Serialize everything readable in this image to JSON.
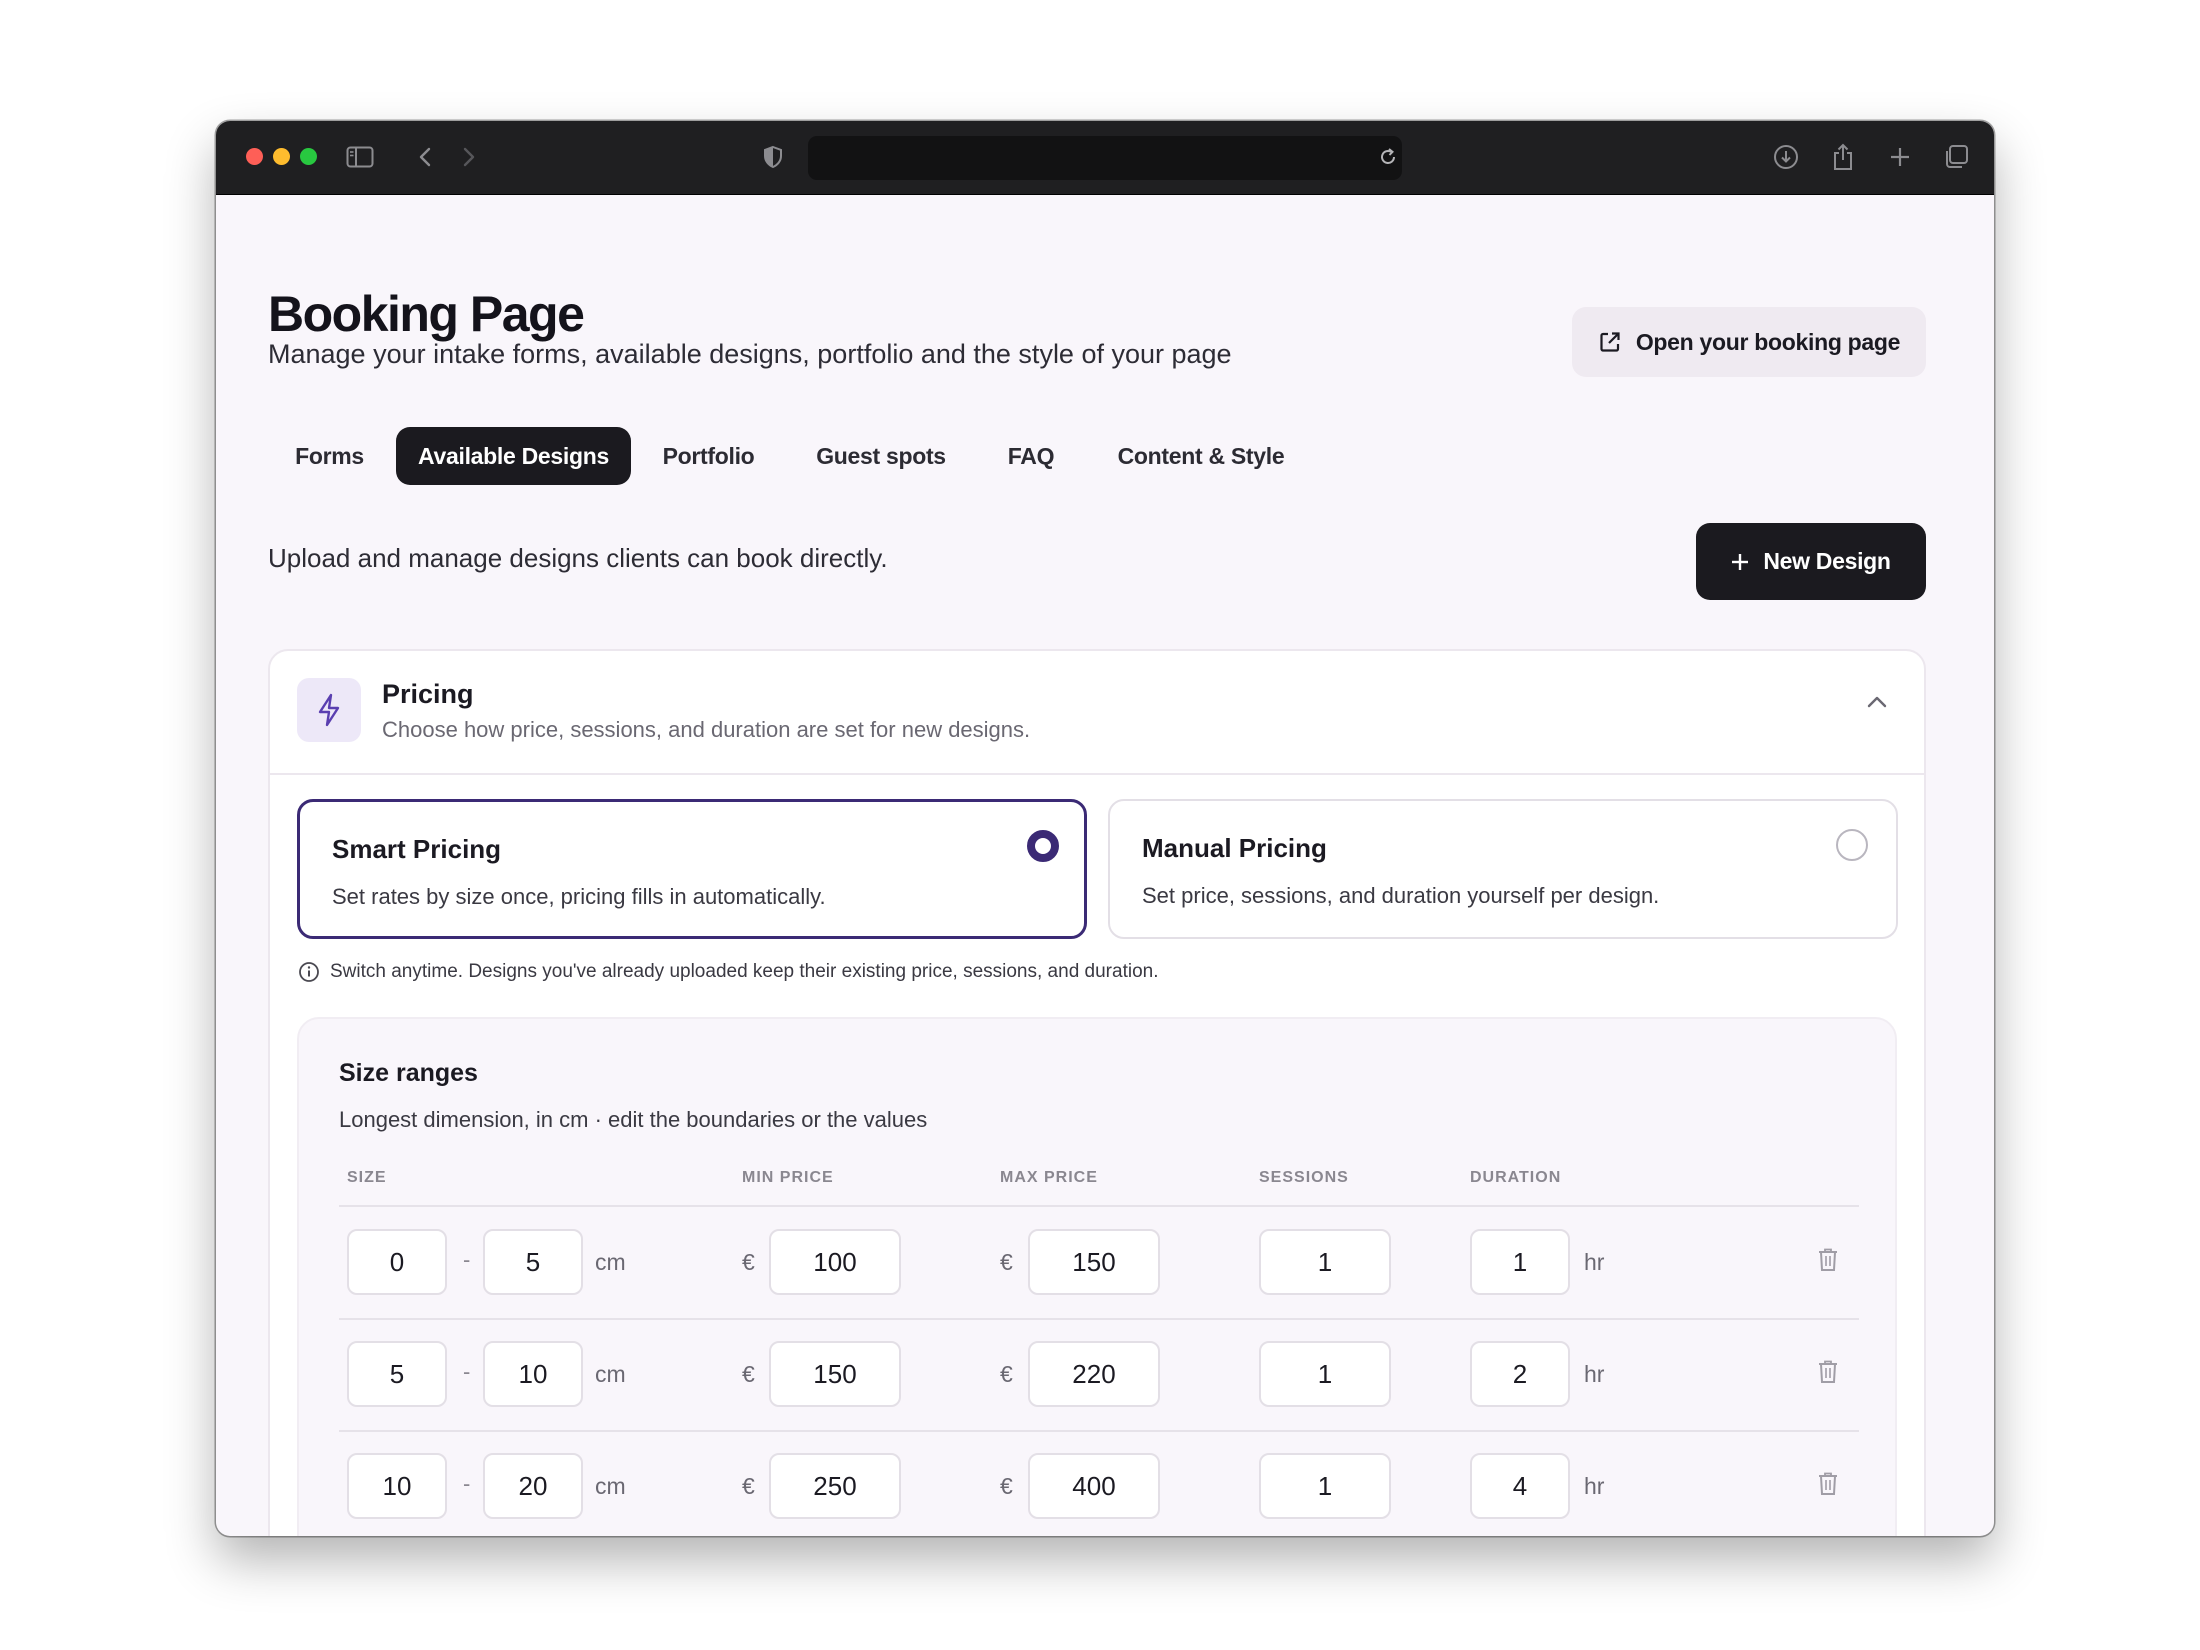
{
  "browser": {
    "icons": [
      "sidebar-icon",
      "back-icon",
      "forward-icon",
      "shield-icon",
      "reload-icon",
      "download-icon",
      "share-icon",
      "new-tab-icon",
      "tabs-overview-icon"
    ]
  },
  "header": {
    "title": "Booking Page",
    "subtitle": "Manage your intake forms, available designs, portfolio and the style of your page",
    "open_button": "Open your booking page"
  },
  "tabs": [
    {
      "label": "Forms",
      "active": false
    },
    {
      "label": "Available Designs",
      "active": true
    },
    {
      "label": "Portfolio",
      "active": false
    },
    {
      "label": "Guest spots",
      "active": false
    },
    {
      "label": "FAQ",
      "active": false
    },
    {
      "label": "Content & Style",
      "active": false
    }
  ],
  "section": {
    "description": "Upload and manage designs clients can book directly.",
    "new_button": "New Design"
  },
  "pricing": {
    "title": "Pricing",
    "subtitle": "Choose how price, sessions, and duration are set for new designs.",
    "options": [
      {
        "title": "Smart Pricing",
        "description": "Set rates by size once, pricing fills in automatically.",
        "selected": true
      },
      {
        "title": "Manual Pricing",
        "description": "Set price, sessions, and duration yourself per design.",
        "selected": false
      }
    ],
    "note": "Switch anytime. Designs you've already uploaded keep their existing price, sessions, and duration.",
    "accent_color": "#3b2a75"
  },
  "size_ranges": {
    "title": "Size ranges",
    "subtitle": "Longest dimension, in cm · edit the boundaries or the values",
    "columns": [
      "SIZE",
      "MIN PRICE",
      "MAX PRICE",
      "SESSIONS",
      "DURATION"
    ],
    "size_unit": "cm",
    "separator": "-",
    "currency": "€",
    "duration_unit": "hr",
    "rows": [
      {
        "from": "0",
        "to": "5",
        "min_price": "100",
        "max_price": "150",
        "sessions": "1",
        "duration": "1"
      },
      {
        "from": "5",
        "to": "10",
        "min_price": "150",
        "max_price": "220",
        "sessions": "1",
        "duration": "2"
      },
      {
        "from": "10",
        "to": "20",
        "min_price": "250",
        "max_price": "400",
        "sessions": "1",
        "duration": "4"
      }
    ]
  }
}
